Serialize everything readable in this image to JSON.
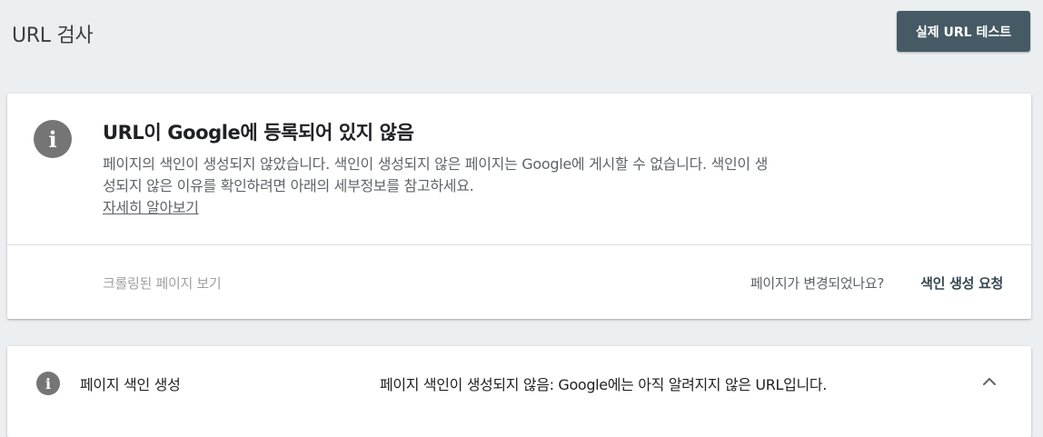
{
  "header": {
    "title": "URL 검사",
    "test_button_label": "실제 URL 테스트"
  },
  "status_card": {
    "icon": "info-icon",
    "title": "URL이 Google에 등록되어 있지 않음",
    "description": "페이지의 색인이 생성되지 않았습니다. 색인이 생성되지 않은 페이지는 Google에 게시할 수 없습니다. 색인이 생성되지 않은 이유를 확인하려면 아래의 세부정보를 참고하세요.",
    "learn_more": "자세히 알아보기",
    "view_crawled": "크롤링된 페이지 보기",
    "changed_question": "페이지가 변경되었나요?",
    "request_indexing": "색인 생성 요청"
  },
  "coverage": {
    "icon": "info-icon",
    "label": "페이지 색인 생성",
    "value": "페이지 색인이 생성되지 않음: Google에는 아직 알려지지 않은 URL입니다.",
    "toggle_icon": "chevron-up-icon"
  },
  "colors": {
    "background": "#eceff1",
    "button": "#455a64",
    "icon": "#757575"
  }
}
